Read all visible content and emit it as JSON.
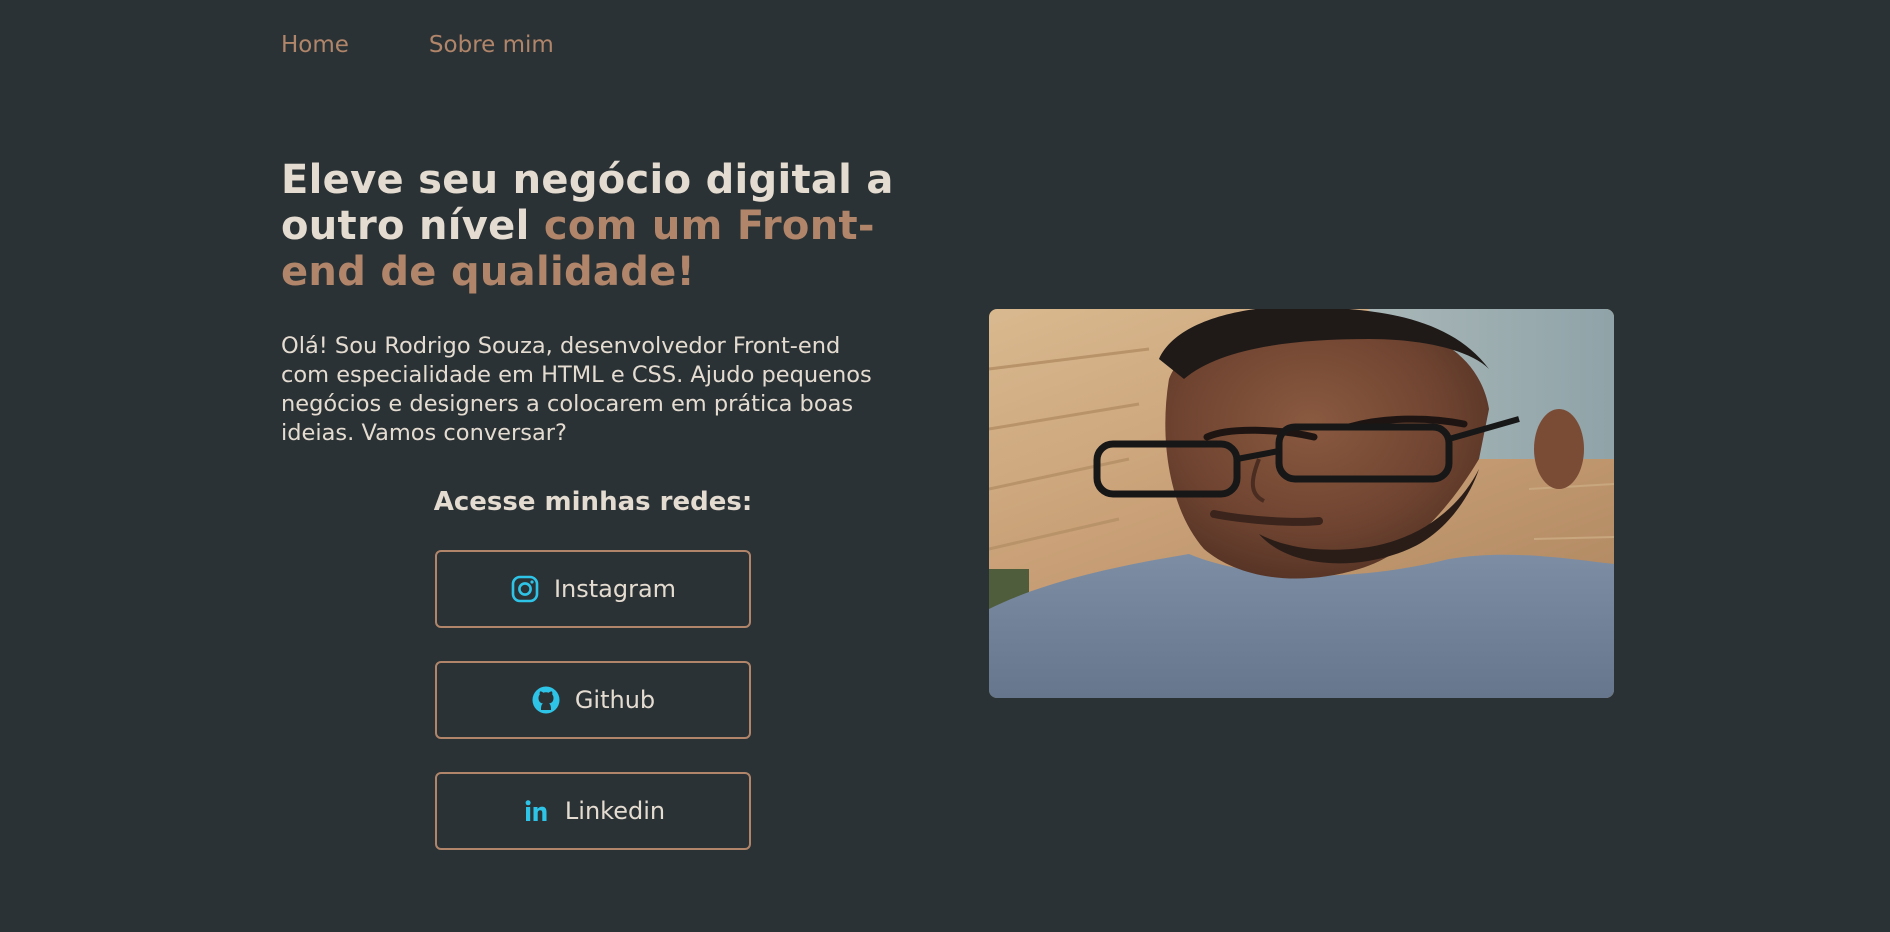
{
  "nav": {
    "items": [
      {
        "label": "Home"
      },
      {
        "label": "Sobre mim"
      }
    ]
  },
  "hero": {
    "headline_part1": "Eleve seu negócio digital a outro nível ",
    "headline_accent": "com um Front-end de qualidade!",
    "intro": "Olá! Sou Rodrigo Souza, desenvolvedor Front-end com especialidade em HTML e CSS. Ajudo pequenos negócios e designers a colocarem em prática boas ideias. Vamos conversar?"
  },
  "social": {
    "title": "Acesse minhas redes:",
    "links": [
      {
        "label": "Instagram",
        "icon": "instagram-icon"
      },
      {
        "label": "Github",
        "icon": "github-icon"
      },
      {
        "label": "Linkedin",
        "icon": "linkedin-icon"
      }
    ]
  },
  "colors": {
    "background": "#2b3235",
    "text": "#e4dcd1",
    "accent": "#b0856a",
    "icon": "#2ec4e8"
  }
}
